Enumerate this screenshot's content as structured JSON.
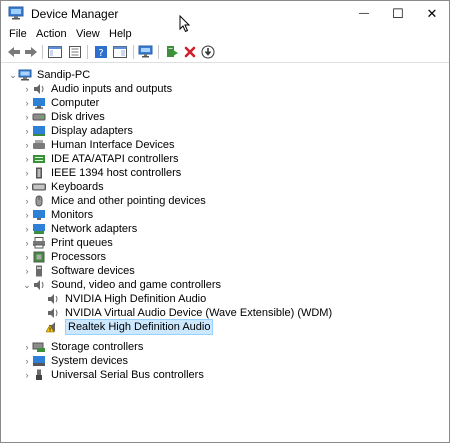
{
  "window": {
    "title": "Device Manager"
  },
  "window_buttons": {
    "minimize": "—",
    "maximize": "☐",
    "close": "✕"
  },
  "menu": [
    {
      "label": "File"
    },
    {
      "label": "Action"
    },
    {
      "label": "View"
    },
    {
      "label": "Help"
    }
  ],
  "toolbar": {
    "buttons": [
      "back-arrow-icon",
      "forward-arrow-icon",
      "show-hide-console-tree-icon",
      "properties-icon",
      "help-icon",
      "action-pane-icon",
      "scan-hardware-icon",
      "update-driver-icon",
      "uninstall-icon",
      "disable-device-icon"
    ]
  },
  "tree": {
    "root": "Sandip-PC",
    "categories": [
      {
        "label": "Audio inputs and outputs",
        "icon": "speaker-icon"
      },
      {
        "label": "Computer",
        "icon": "computer-icon"
      },
      {
        "label": "Disk drives",
        "icon": "disk-drive-icon"
      },
      {
        "label": "Display adapters",
        "icon": "display-adapter-icon"
      },
      {
        "label": "Human Interface Devices",
        "icon": "hid-icon"
      },
      {
        "label": "IDE ATA/ATAPI controllers",
        "icon": "ide-controller-icon"
      },
      {
        "label": "IEEE 1394 host controllers",
        "icon": "ieee1394-icon"
      },
      {
        "label": "Keyboards",
        "icon": "keyboard-icon"
      },
      {
        "label": "Mice and other pointing devices",
        "icon": "mouse-icon"
      },
      {
        "label": "Monitors",
        "icon": "monitor-icon"
      },
      {
        "label": "Network adapters",
        "icon": "network-adapter-icon"
      },
      {
        "label": "Print queues",
        "icon": "printer-icon"
      },
      {
        "label": "Processors",
        "icon": "processor-icon"
      },
      {
        "label": "Software devices",
        "icon": "software-device-icon"
      },
      {
        "label": "Sound, video and game controllers",
        "icon": "speaker-icon",
        "expanded": true,
        "children": [
          {
            "label": "NVIDIA High Definition Audio",
            "icon": "speaker-icon"
          },
          {
            "label": "NVIDIA Virtual Audio Device (Wave Extensible) (WDM)",
            "icon": "speaker-icon"
          },
          {
            "label": "Realtek High Definition Audio",
            "icon": "warning-speaker-icon",
            "selected": true
          }
        ]
      },
      {
        "label": "Storage controllers",
        "icon": "storage-controller-icon"
      },
      {
        "label": "System devices",
        "icon": "system-device-icon"
      },
      {
        "label": "Universal Serial Bus controllers",
        "icon": "usb-icon"
      }
    ]
  },
  "colors": {
    "selection": "#cce8ff",
    "selection_border": "#99d1ff",
    "accent": "#1e6fd0"
  }
}
